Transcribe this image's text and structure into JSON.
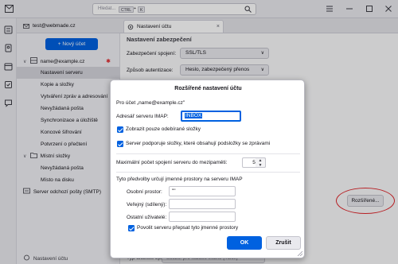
{
  "titlebar": {
    "search_placeholder": "Hledat...",
    "shortcut_key1": "CTRL",
    "shortcut_plus": "+",
    "shortcut_key2": "K"
  },
  "tabs": [
    {
      "label": "test@webmade.cz"
    },
    {
      "label": "Nastavení účtu"
    }
  ],
  "tree": {
    "new_account": "+ Nový účet",
    "rows": [
      "name@example.cz",
      "Nastavení serveru",
      "Kopie a složky",
      "Vytváření zpráv a adresování",
      "Nevyžádaná pošta",
      "Synchronizace a úložiště",
      "Koncové šifrování",
      "Potvrzení o přečtení",
      "Místní složky",
      "Nevyžádaná pošta",
      "Místo na disku",
      "Server odchozí pošty (SMTP)"
    ],
    "bottom_settings": "Nastavení účtu"
  },
  "main": {
    "heading": "Nastavení zabezpečení",
    "security_label": "Zabezpečení spojení:",
    "security_value": "SSL/TLS",
    "auth_label": "Způsob autentizace:",
    "auth_value": "Heslo, zabezpečený přenos",
    "advanced_button": "Rozšířené...",
    "storage_label": "Typ úložiště zpráv:",
    "storage_value": "Soubor pro každou složku (mbox)"
  },
  "dialog": {
    "title": "Rozšířené nastavení účtu",
    "for_account": "Pro účet „name@example.cz\"",
    "imap_label": "Adresář serveru IMAP:",
    "imap_value": "INBOX",
    "chk_subscribed": "Zobrazit pouze odebírané složky",
    "chk_subfolders": "Server podporuje složky, které obsahují podsložky se zprávami",
    "conn_label": "Maximální počet spojení serveru do mezipaměti:",
    "conn_value": "5",
    "ns_heading": "Tyto předvolby určují jmenné prostory na serveru IMAP",
    "personal_label": "Osobní prostor:",
    "personal_value": "\"\"",
    "public_label": "Veřejný (sdílený):",
    "public_value": "",
    "other_label": "Ostatní uživatelé:",
    "other_value": "",
    "chk_override": "Povolit serveru přepsat tyto jmenné prostory",
    "ok": "OK",
    "cancel": "Zrušit"
  },
  "colors": {
    "accent": "#0061e0",
    "highlight_ring": "#e0272c"
  }
}
